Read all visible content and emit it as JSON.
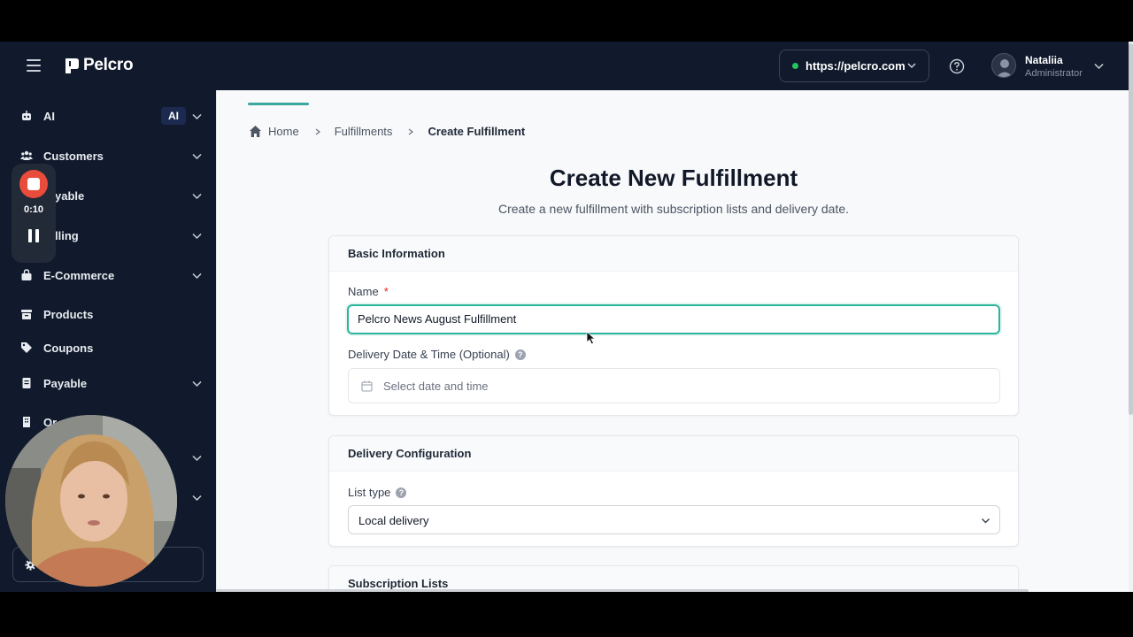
{
  "app": {
    "logo_text": "Pelcro",
    "site_url": "https://pelcro.com",
    "user_name": "Nataliia",
    "user_role": "Administrator"
  },
  "sidebar": {
    "items": [
      {
        "label": "AI",
        "badge": "AI"
      },
      {
        "label": "Customers"
      },
      {
        "label": "yable"
      },
      {
        "label": "lling"
      },
      {
        "label": "E-Commerce"
      },
      {
        "label": "Products"
      },
      {
        "label": "Coupons"
      },
      {
        "label": "Payable"
      },
      {
        "label": "Or"
      }
    ]
  },
  "recording": {
    "time": "0:10"
  },
  "breadcrumb": {
    "home": "Home",
    "section": "Fulfillments",
    "current": "Create Fulfillment"
  },
  "page": {
    "title": "Create New Fulfillment",
    "subtitle": "Create a new fulfillment with subscription lists and delivery date."
  },
  "basic_info": {
    "heading": "Basic Information",
    "name_label": "Name",
    "required_mark": "*",
    "name_value": "Pelcro News August Fulfillment",
    "delivery_label": "Delivery Date & Time (Optional)",
    "delivery_placeholder": "Select date and time",
    "help_glyph": "?"
  },
  "delivery_config": {
    "heading": "Delivery Configuration",
    "list_type_label": "List type",
    "list_type_value": "Local delivery",
    "help_glyph": "?"
  },
  "subscription_lists": {
    "heading": "Subscription Lists"
  },
  "colors": {
    "topbar": "#111a2c",
    "accent": "#2bb59b",
    "record": "#ea4c3c"
  }
}
